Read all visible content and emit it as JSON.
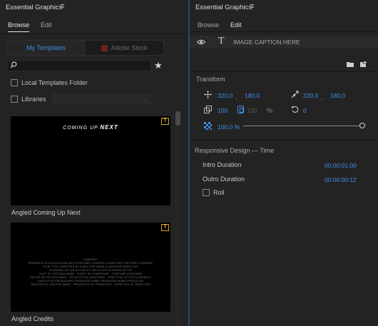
{
  "left_panel": {
    "title": "Essential Graphics",
    "menu_glyph": "≡",
    "tabs": [
      "Browse",
      "Edit"
    ],
    "active_tab": "Browse",
    "segmented": {
      "my_templates": "My Templates",
      "adobe_stock": "Adobe Stock"
    },
    "search": {
      "value": "",
      "placeholder": ""
    },
    "star_glyph": "★",
    "local_templates_folder": "Local Templates Folder",
    "libraries": "Libraries",
    "templates": [
      {
        "name": "Angled Coming Up Next",
        "preview_text_prefix": "COMING UP ",
        "preview_text_bold": "NEXT",
        "badge": "T"
      },
      {
        "name": "Angled Credits",
        "badge": "T",
        "credit_lines": [
          "COMPANY",
          "PRESENTS IN ASSOCIATION WITH PARTNER COMPANY A ANOTHER PARTNER COMPANY",
          "FILM TITLE DIRECTED BY DIRECTOR NAME A ANOTHER DIRECTOR",
          "STARRING ACTOR ACTOR ACTOR ACTOR ACTRESS ACTOR",
          "CAST BY CASTING NAME · MUSIC BY COMPOSER · COSTUME DESIGNER",
          "EDITED BY EDITOR NAME · PRODUCTION DESIGNER · DIRECTOR OF PHOTOGRAPHY",
          "EXECUTIVE PRODUCERS PRODUCER NAME PRODUCER NAME PRODUCER",
          "WRITTEN BY WRITER NAME · PRODUCED BY PRODUCER · DIRECTED BY DIRECTOR"
        ]
      }
    ]
  },
  "right_panel": {
    "title": "Essential Graphics",
    "menu_glyph": "≡",
    "tabs": [
      "Browse",
      "Edit"
    ],
    "active_tab": "Edit",
    "layer": {
      "type_glyph": "T",
      "name": "IMAGE CAPTION HERE"
    },
    "transform": {
      "title": "Transform",
      "position_x": "320,0",
      "comma": ",",
      "position_y": "180,0",
      "anchor_x": "320,0",
      "anchor_y": "180,0",
      "scale": "100",
      "scale_height": "100",
      "scale_unit": "%",
      "rotation": "0",
      "opacity": "100,0 %",
      "opacity_level": 1.0
    },
    "responsive": {
      "title": "Responsive Design — Time",
      "intro_label": "Intro Duration",
      "intro_value": "00:00:01:00",
      "outro_label": "Outro Duration",
      "outro_value": "00:00:00:12",
      "roll_label": "Roll"
    }
  },
  "colors": {
    "accent": "#3f8fe8",
    "panel_bg": "#232323",
    "badge": "#d4a52a"
  }
}
